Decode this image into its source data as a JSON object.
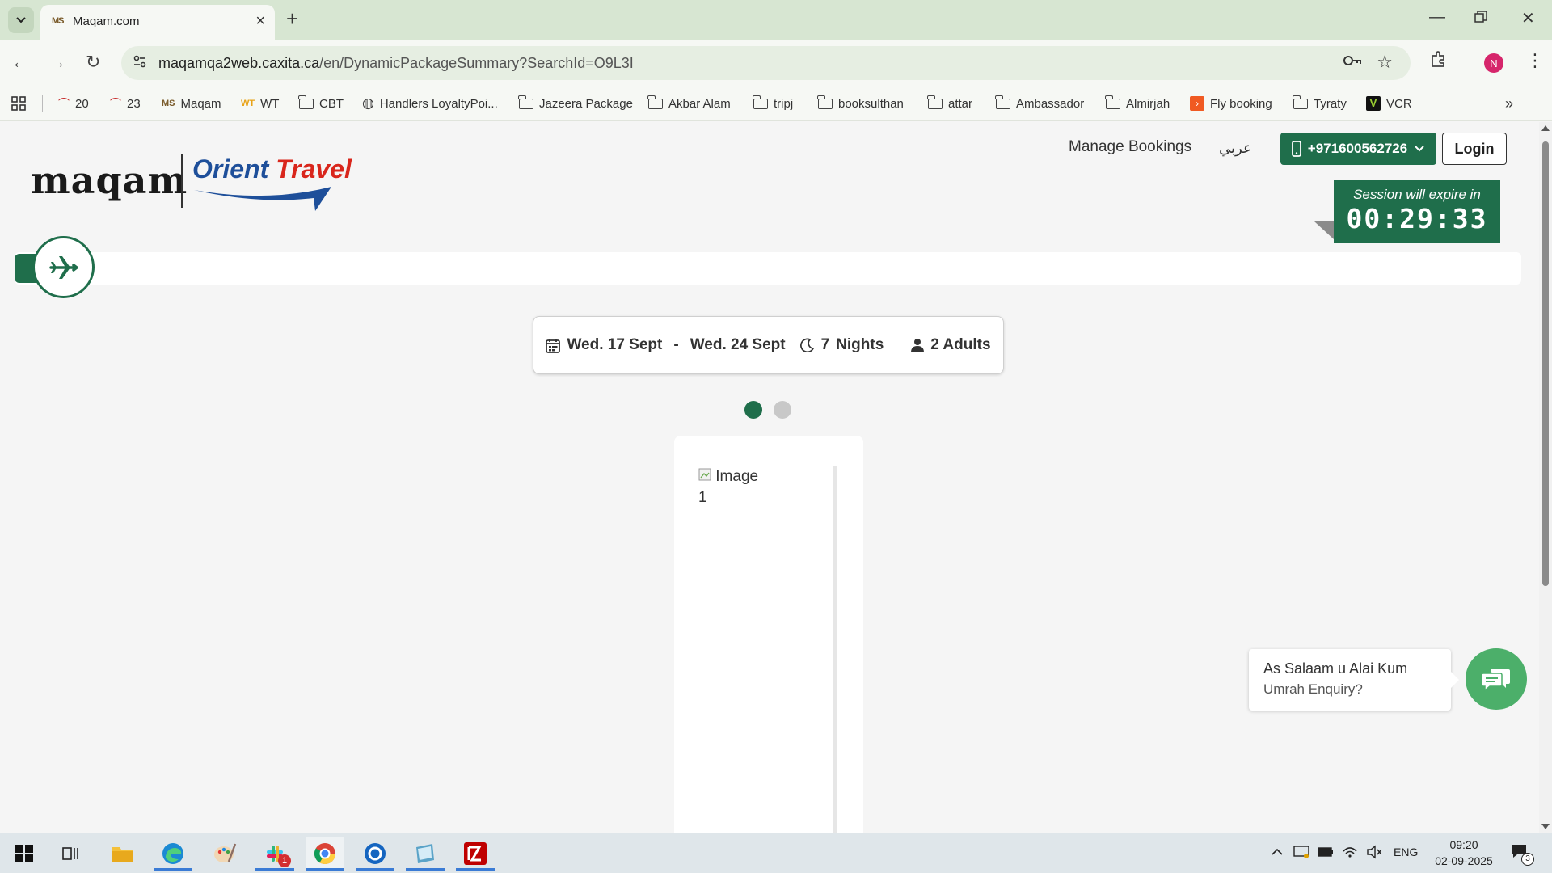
{
  "browser": {
    "tab": {
      "title": "Maqam.com",
      "favicon": "MS"
    },
    "url": {
      "host": "maqamqa2web.caxita.ca",
      "path": "/en/DynamicPackageSummary?SearchId=O9L3I"
    },
    "profile_initial": "N",
    "bookmarks": [
      {
        "label": "20",
        "icon": "arch-icon"
      },
      {
        "label": "23",
        "icon": "arch-icon"
      },
      {
        "label": "Maqam",
        "icon": "maqam-favicon"
      },
      {
        "label": "WT",
        "icon": "wt-favicon"
      },
      {
        "label": "CBT",
        "icon": "folder-icon"
      },
      {
        "label": "Handlers LoyaltyPoi...",
        "icon": "globe-icon"
      },
      {
        "label": "Jazeera Package",
        "icon": "folder-icon"
      },
      {
        "label": "Akbar Alam",
        "icon": "folder-icon"
      },
      {
        "label": "tripj",
        "icon": "folder-icon"
      },
      {
        "label": "booksulthan",
        "icon": "folder-icon"
      },
      {
        "label": "attar",
        "icon": "folder-icon"
      },
      {
        "label": "Ambassador",
        "icon": "folder-icon"
      },
      {
        "label": "Almirjah",
        "icon": "folder-icon"
      },
      {
        "label": "Fly booking",
        "icon": "flybooking-favicon"
      },
      {
        "label": "Tyraty",
        "icon": "folder-icon"
      },
      {
        "label": "VCR",
        "icon": "vcr-favicon"
      }
    ]
  },
  "header": {
    "logo_maqam": "maqam",
    "logo_orient": "Orient",
    "logo_travel": "Travel",
    "manage_bookings": "Manage Bookings",
    "arabic": "عربي",
    "phone": "+971600562726",
    "login": "Login"
  },
  "session": {
    "label": "Session will expire in",
    "time": "00:29:33"
  },
  "trip": {
    "start": "Wed. 17 Sept",
    "separator": "-",
    "end": "Wed. 24 Sept",
    "nights_count": "7",
    "nights_label": "Nights",
    "adults": "2 Adults"
  },
  "carousel": {
    "image_alt": "Image 1",
    "active_index": 0,
    "total": 2
  },
  "chat": {
    "greeting": "As Salaam u Alai Kum",
    "subtitle": "Umrah Enquiry?"
  },
  "taskbar": {
    "language": "ENG",
    "time": "09:20",
    "date": "02-09-2025",
    "slack_badge": "1",
    "notification_count": "3"
  },
  "colors": {
    "brand_green": "#1f6e4b",
    "chat_green": "#4caf6a",
    "orient_blue": "#1e4f9a",
    "chrome_green": "#d7e6d2"
  }
}
